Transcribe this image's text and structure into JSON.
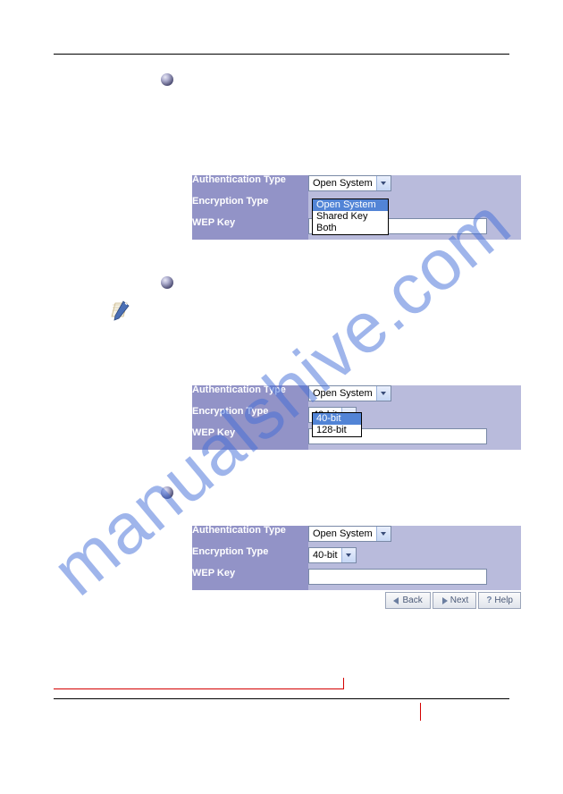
{
  "watermark": "manualshive.com",
  "panel1": {
    "row_auth_label": "Authentication Type",
    "row_auth_value": "Open System",
    "row_enc_label": "Encryption Type",
    "row_wep_label": "WEP Key",
    "dropdown_options": {
      "opt1": "Open System",
      "opt2": "Shared Key",
      "opt3": "Both"
    }
  },
  "panel2": {
    "row_auth_label": "Authentication Type",
    "row_auth_value": "Open System",
    "row_enc_label": "Encryption Type",
    "row_enc_value": "40-bit",
    "row_wep_label": "WEP Key",
    "dropdown_options": {
      "opt1": "40-bit",
      "opt2": "128-bit"
    }
  },
  "panel3": {
    "row_auth_label": "Authentication Type",
    "row_auth_value": "Open System",
    "row_enc_label": "Encryption Type",
    "row_enc_value": "40-bit",
    "row_wep_label": "WEP Key"
  },
  "buttons": {
    "back": "Back",
    "next": "Next",
    "help": "Help"
  }
}
